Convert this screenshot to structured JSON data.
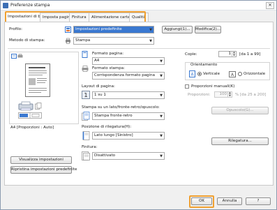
{
  "window": {
    "title": "Preferenze stampa"
  },
  "tabs": [
    {
      "label": "Impostazioni di base",
      "active": true
    },
    {
      "label": "Imposta pagina",
      "active": false
    },
    {
      "label": "Finitura",
      "active": false
    },
    {
      "label": "Alimentazione carta",
      "active": false
    },
    {
      "label": "Qualità",
      "active": false
    }
  ],
  "profile": {
    "label": "Profilo:",
    "value": "Impostazioni predefinite",
    "add_button": "Aggiungi(1)...",
    "edit_button": "Modifica(2)..."
  },
  "output_method": {
    "label": "Metodo di stampa:",
    "value": "Stampa"
  },
  "preview": {
    "caption": "A4 [Proporzioni : Auto]",
    "view_settings_button": "Visualizza impostazioni",
    "restore_defaults_button": "Ripristina impostazioni predefinite"
  },
  "page_size": {
    "label": "Formato pagina:",
    "value": "A4"
  },
  "output_size": {
    "label": "Formato stampa:",
    "value": "Corrispondenza formato pagina"
  },
  "copies": {
    "label": "Copie:",
    "value": "1",
    "range": "[da 1 a 99]"
  },
  "orientation": {
    "group_label": "Orientamento",
    "portrait_label": "Verticale",
    "landscape_label": "Orizzontale",
    "selected": "Verticale"
  },
  "page_layout": {
    "label": "Layout di pagina:",
    "value": "1 su 1"
  },
  "manual_scaling": {
    "checkbox_label": "Proporzioni manuali(K)",
    "checked": false,
    "scaling_label": "Proporzioni:",
    "scaling_value": "100",
    "scaling_range": "% [da 25 a 200]"
  },
  "duplex": {
    "label": "Stampa su un lato/fronte-retro/opuscolo:",
    "value": "Stampa fronte-retro",
    "booklet_button": "Opuscolo(G)..."
  },
  "binding": {
    "label": "Posizione di rilegatura(H):",
    "value": "Lato lungo [Sinistro]",
    "gutter_button": "Rilegatura..."
  },
  "finishing": {
    "label": "Finitura:",
    "value": "Disattivato"
  },
  "footer": {
    "ok_button": "OK",
    "cancel_button": "Annulla",
    "help_button": "?"
  }
}
